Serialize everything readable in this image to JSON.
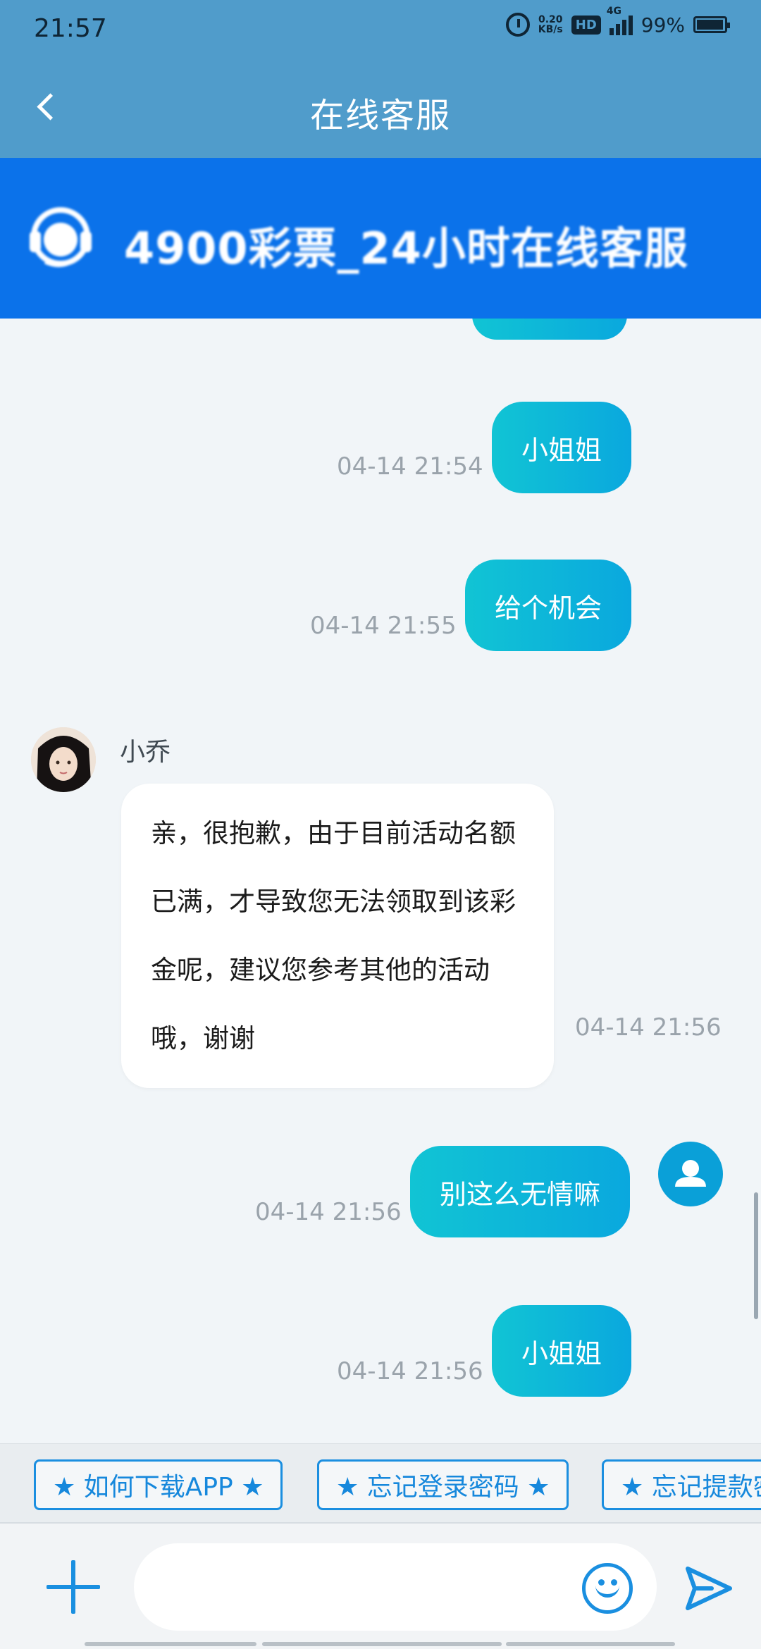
{
  "status_bar": {
    "time": "21:57",
    "net_speed_value": "0.20",
    "net_speed_unit": "KB/s",
    "hd": "HD",
    "network": "4G",
    "battery": "99%"
  },
  "header": {
    "title": "在线客服"
  },
  "banner": {
    "text": "4900彩票_24小时在线客服"
  },
  "messages": [
    {
      "from": "user",
      "text": "小姐姐",
      "time": "04-14 21:54"
    },
    {
      "from": "user",
      "text": "给个机会",
      "time": "04-14 21:55"
    },
    {
      "from": "agent",
      "name": "小乔",
      "text": "亲，很抱歉，由于目前活动名额已满，才导致您无法领取到该彩金呢，建议您参考其他的活动哦，谢谢",
      "time": "04-14 21:56"
    },
    {
      "from": "user",
      "text": "别这么无情嘛",
      "time": "04-14 21:56"
    },
    {
      "from": "user",
      "text": "小姐姐",
      "time": "04-14 21:56"
    }
  ],
  "quick_replies": [
    "★ 如何下载APP ★",
    "★ 忘记登录密码 ★",
    "★ 忘记提款密码 ★"
  ],
  "input": {
    "value": "",
    "placeholder": ""
  },
  "colors": {
    "header": "#509ccb",
    "banner": "#0b72ea",
    "accent": "#1a8fe0",
    "bubble_start": "#11c4d4",
    "bubble_end": "#0aa8de"
  },
  "icons": {
    "back": "chevron-left-icon",
    "plus": "plus-icon",
    "emoji": "smiley-icon",
    "send": "send-icon",
    "user_avatar": "person-icon"
  }
}
